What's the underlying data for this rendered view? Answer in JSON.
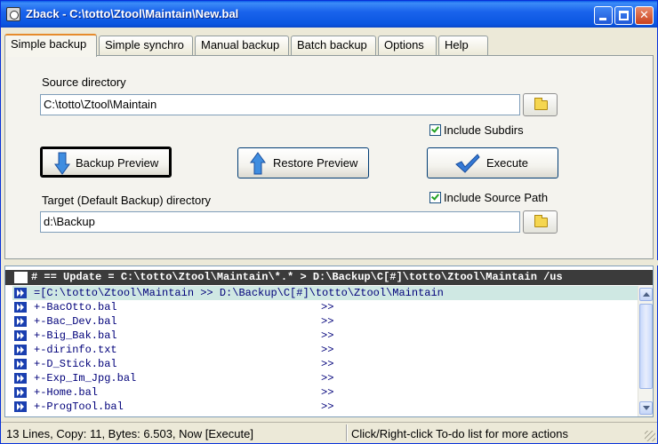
{
  "window": {
    "title": "Zback - C:\\totto\\Ztool\\Maintain\\New.bal"
  },
  "tabs": [
    {
      "label": "Simple backup",
      "active": true
    },
    {
      "label": "Simple synchro",
      "active": false
    },
    {
      "label": "Manual backup",
      "active": false
    },
    {
      "label": "Batch backup",
      "active": false
    },
    {
      "label": "Options",
      "active": false
    },
    {
      "label": "Help",
      "active": false
    }
  ],
  "simple_backup": {
    "source_label": "Source directory",
    "source_value": "C:\\totto\\Ztool\\Maintain",
    "include_subdirs_label": "Include Subdirs",
    "include_subdirs_checked": true,
    "backup_preview_label": "Backup Preview",
    "restore_preview_label": "Restore Preview",
    "execute_label": "Execute",
    "target_label": "Target (Default Backup) directory",
    "target_value": "d:\\Backup",
    "include_source_path_label": "Include Source Path",
    "include_source_path_checked": true
  },
  "log": {
    "header": "# == Update = C:\\totto\\Ztool\\Maintain\\*.* > D:\\Backup\\C[#]\\totto\\Ztool\\Maintain  /us",
    "rows": [
      {
        "text": "=[C:\\totto\\Ztool\\Maintain >> D:\\Backup\\C[#]\\totto\\Ztool\\Maintain",
        "action": ""
      },
      {
        "text": "+-BacOtto.bal",
        "action": ">>"
      },
      {
        "text": "+-Bac_Dev.bal",
        "action": ">>"
      },
      {
        "text": "+-Big_Bak.bal",
        "action": ">>"
      },
      {
        "text": "+-dirinfo.txt",
        "action": ">>"
      },
      {
        "text": "+-D_Stick.bal",
        "action": ">>"
      },
      {
        "text": "+-Exp_Im_Jpg.bal",
        "action": ">>"
      },
      {
        "text": "+-Home.bal",
        "action": ">>"
      },
      {
        "text": "+-ProgTool.bal",
        "action": ">>"
      }
    ]
  },
  "status": {
    "left": "13 Lines, Copy: 11,  Bytes: 6.503, Now [Execute]",
    "right": "Click/Right-click To-do list for more actions"
  },
  "colors": {
    "titlebar": "#0a55e0",
    "active_tab_accent": "#e68b2c",
    "log_text": "#00007a",
    "log_header_bg": "#3b3b3b",
    "selected_row": "#cfe8e3",
    "check_green": "#21a121"
  }
}
